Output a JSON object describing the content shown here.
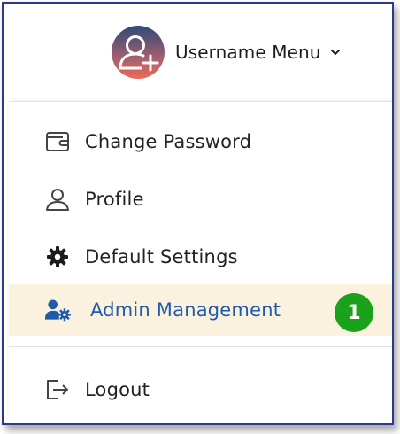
{
  "header": {
    "username_label": "Username Menu",
    "avatar_icon": "user-plus-icon",
    "chevron_icon": "chevron-down-icon"
  },
  "menu": {
    "items": [
      {
        "label": "Change Password",
        "icon": "wallet-icon"
      },
      {
        "label": "Profile",
        "icon": "user-outline-icon"
      },
      {
        "label": "Default Settings",
        "icon": "gear-icon"
      },
      {
        "label": "Admin Management",
        "icon": "users-cog-icon",
        "active": true,
        "badge": "1"
      },
      {
        "label": "Logout",
        "icon": "logout-icon"
      }
    ]
  },
  "colors": {
    "border": "#2b3a8f",
    "active_bg": "#fbf1df",
    "active_text": "#1f5ba8",
    "badge_bg": "#1aa31a"
  }
}
